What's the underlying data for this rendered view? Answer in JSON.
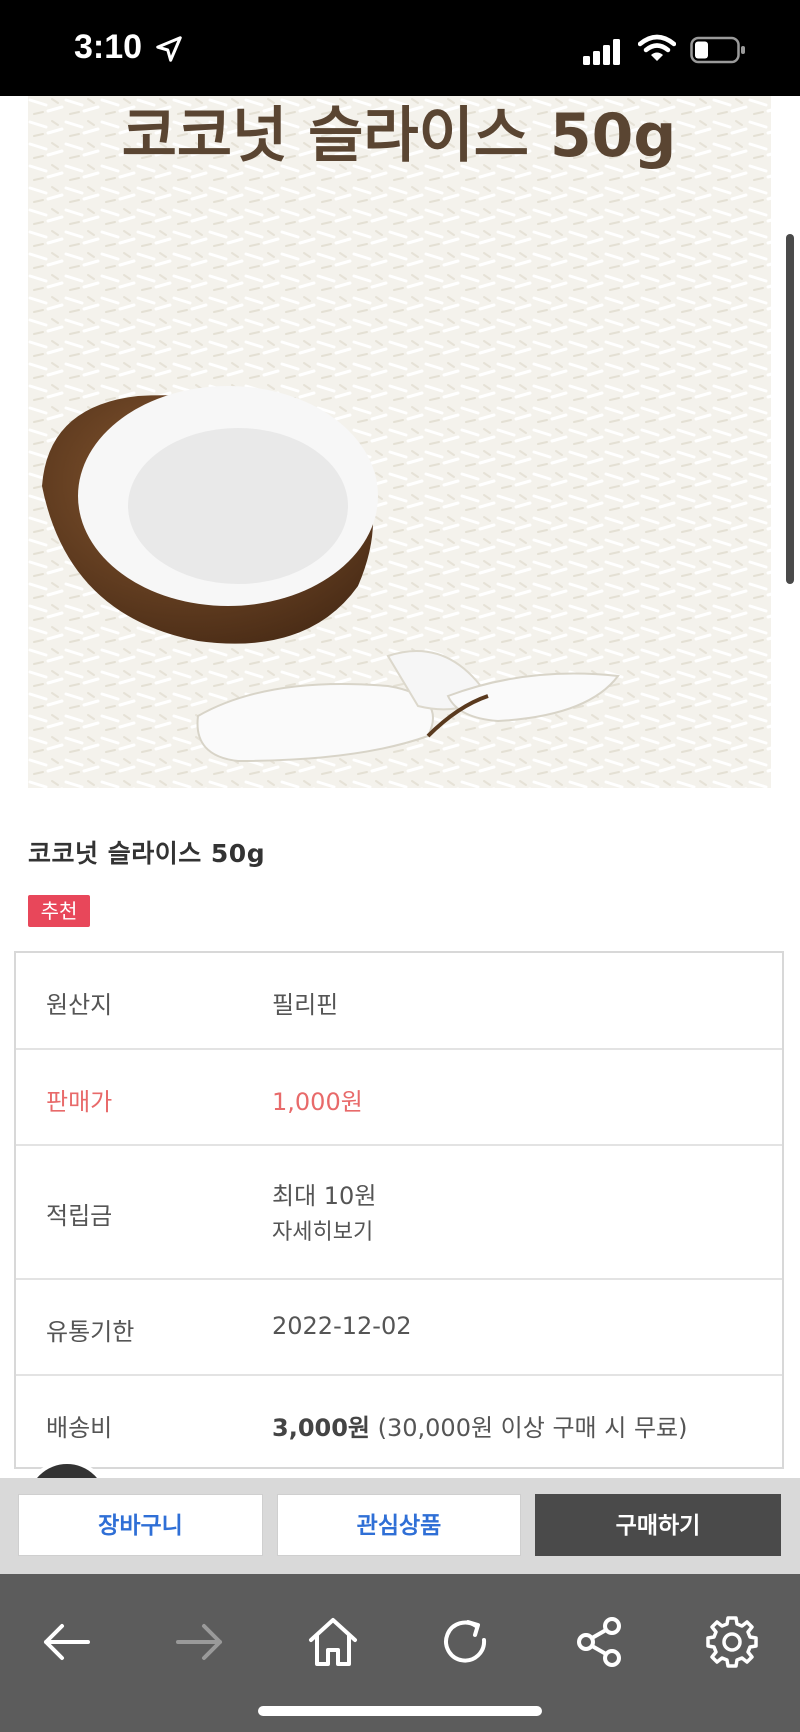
{
  "status_bar": {
    "time": "3:10"
  },
  "product": {
    "image_heading": "코코넛 슬라이스 50g",
    "name": "코코넛 슬라이스 50g",
    "badge": "추천"
  },
  "info": {
    "origin": {
      "label": "원산지",
      "value": "필리핀"
    },
    "price": {
      "label": "판매가",
      "value": "1,000원"
    },
    "points": {
      "label": "적립금",
      "value": "최대 10원",
      "detail_link": "자세히보기"
    },
    "expiry": {
      "label": "유통기한",
      "value": "2022-12-02"
    },
    "shipping": {
      "label": "배송비",
      "value_bold": "3,000원",
      "value_note": " (30,000원 이상 구매 시 무료)"
    }
  },
  "actions": {
    "cart": "장바구니",
    "wishlist": "관심상품",
    "buy": "구매하기"
  },
  "nav_icons": [
    "back-arrow-icon",
    "forward-arrow-icon",
    "home-icon",
    "refresh-icon",
    "share-icon",
    "settings-gear-icon"
  ],
  "colors": {
    "price": "#e86a6a",
    "badge": "#e8475a",
    "action_text": "#2f6fd6",
    "buy_bg": "#4a4a4a",
    "nav_bg": "#5c5c5c"
  }
}
